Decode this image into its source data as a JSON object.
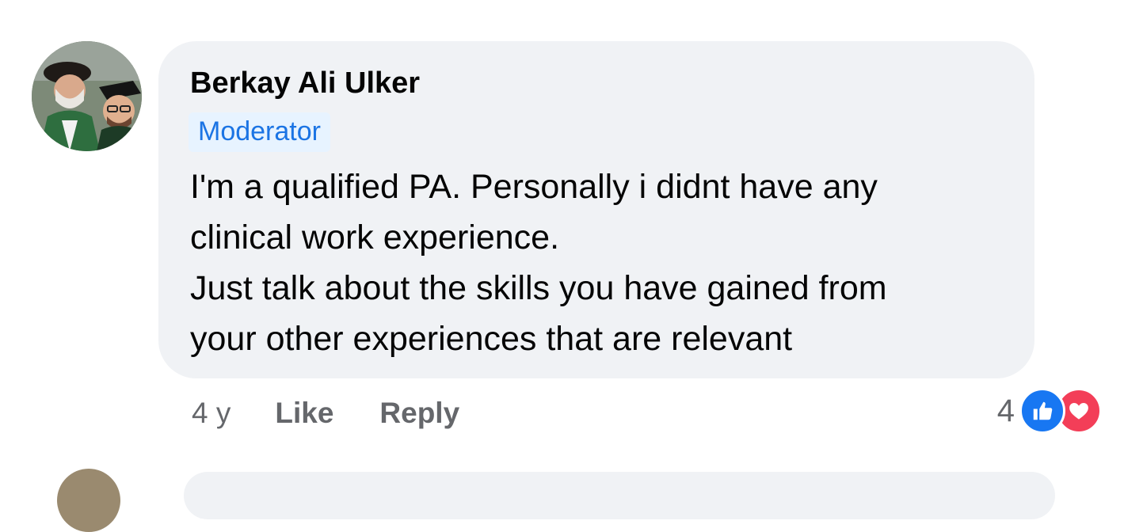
{
  "comment": {
    "author": "Berkay Ali Ulker",
    "role_badge": "Moderator",
    "text_lines": [
      "I'm a qualified PA. Personally i didnt have any",
      "clinical work experience.",
      "Just talk about the skills you have gained from",
      "your other experiences that are relevant"
    ],
    "avatar_icon": "user-photo-avatar",
    "actions": {
      "timestamp": "4 y",
      "like_label": "Like",
      "reply_label": "Reply"
    },
    "reactions": {
      "count": "4",
      "types": [
        "like-icon",
        "love-icon"
      ]
    }
  },
  "colors": {
    "bubble_bg": "#f0f2f5",
    "badge_bg": "#e7f3ff",
    "badge_text": "#1b74e4",
    "secondary_text": "#65676b",
    "like_blue": "#1877f2",
    "love_red": "#f33e58"
  }
}
